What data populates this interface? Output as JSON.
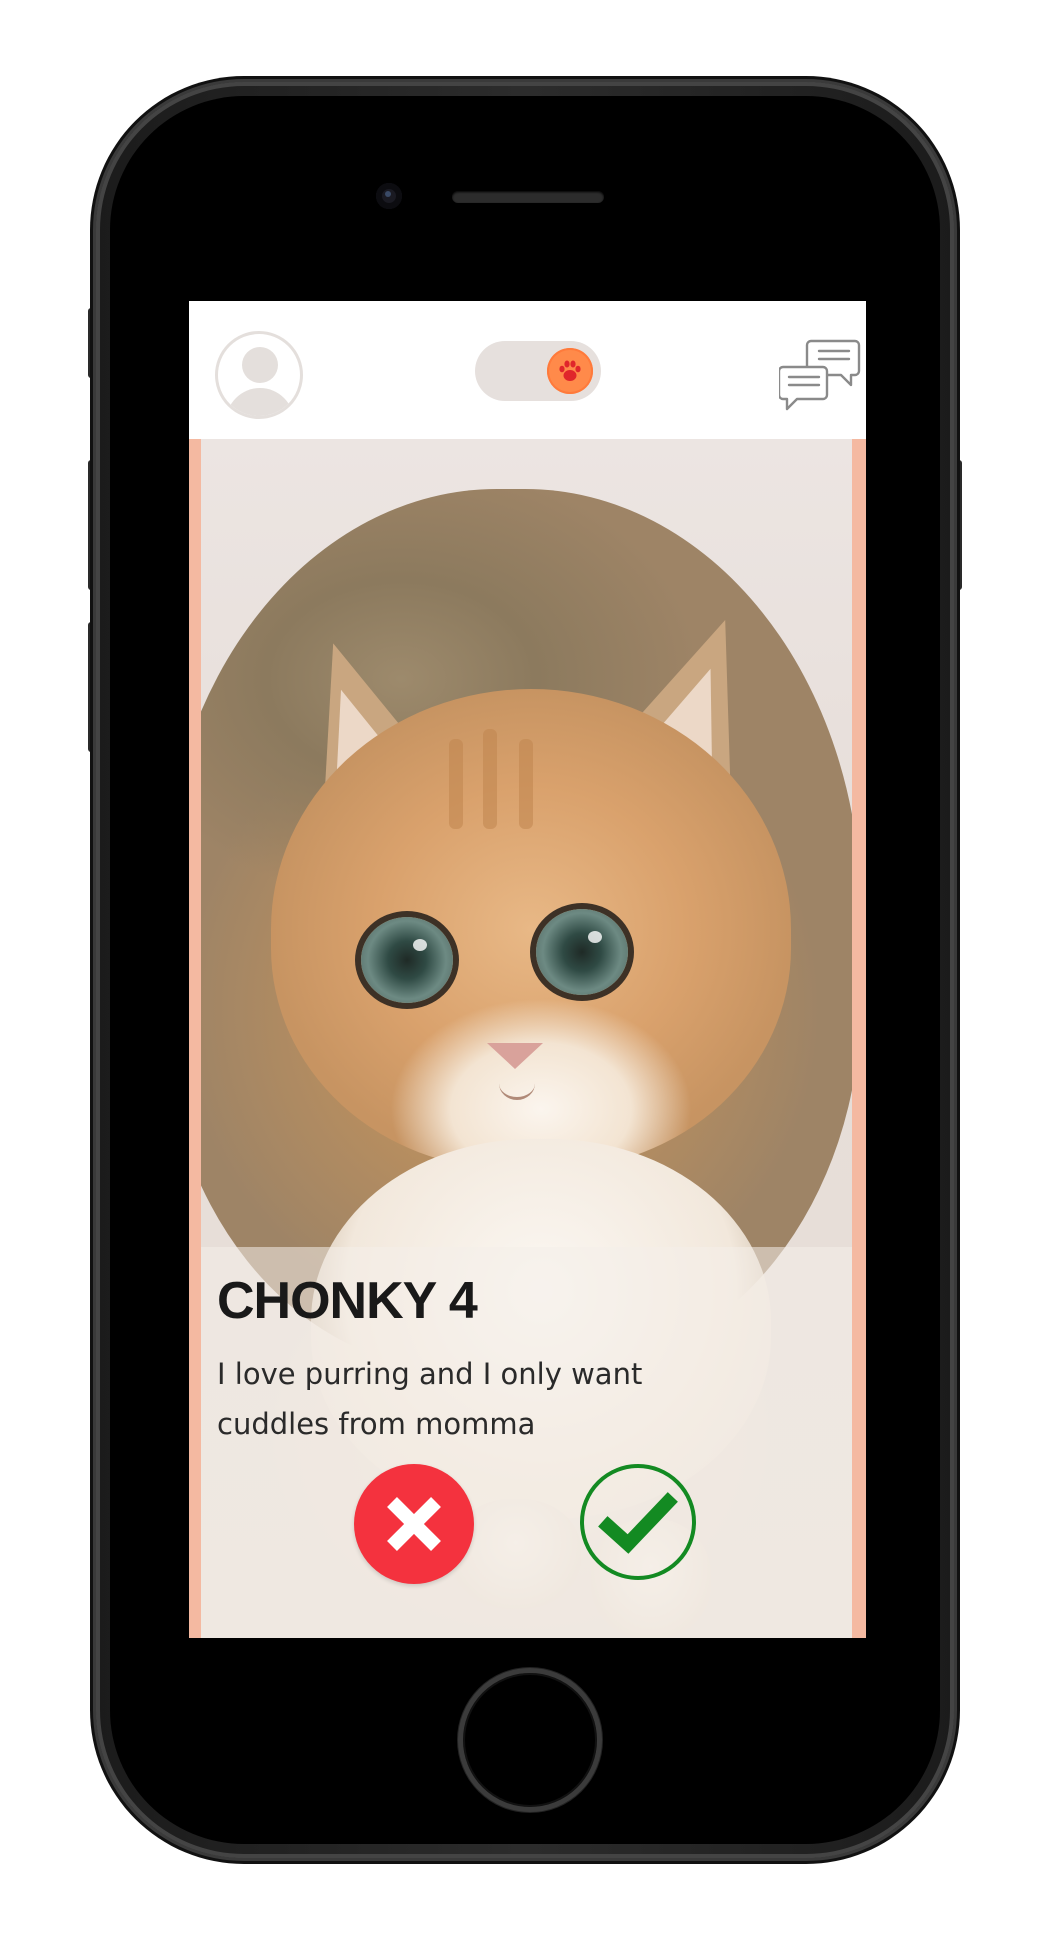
{
  "header": {
    "profile_icon": "user-avatar-icon",
    "mode_toggle_icon": "paw-icon",
    "messages_icon": "chat-bubbles-icon"
  },
  "profile": {
    "name": "CHONKY 4",
    "bio": "I love purring and I only want cuddles from momma",
    "photo": "ginger-cat-photo"
  },
  "actions": {
    "reject_icon": "close-icon",
    "accept_icon": "check-icon"
  },
  "colors": {
    "accent": "#ff8a4a",
    "card_border": "#f4b9a1",
    "reject": "#f4323e",
    "accept": "#138a22"
  }
}
